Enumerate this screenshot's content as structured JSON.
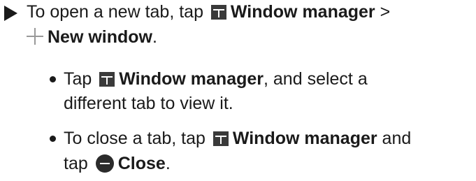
{
  "steps": [
    {
      "line1": {
        "prefix": "To open a new tab, tap",
        "bold": "Window manager",
        "suffix": " >"
      },
      "line2": {
        "bold": "New window",
        "suffix": "."
      },
      "icons": [
        "window-manager-icon",
        "plus-icon"
      ]
    }
  ],
  "bullets": [
    {
      "line1": {
        "prefix": "Tap",
        "bold": "Window manager",
        "suffix": ", and select a"
      },
      "line2": {
        "text": "different tab to view it."
      },
      "icons": [
        "window-manager-icon"
      ]
    },
    {
      "line1": {
        "prefix": "To close a tab, tap",
        "bold": "Window manager",
        "suffix": " and"
      },
      "line2": {
        "prefix": "tap",
        "bold": "Close",
        "suffix": "."
      },
      "icons": [
        "window-manager-icon",
        "close-icon"
      ]
    }
  ]
}
